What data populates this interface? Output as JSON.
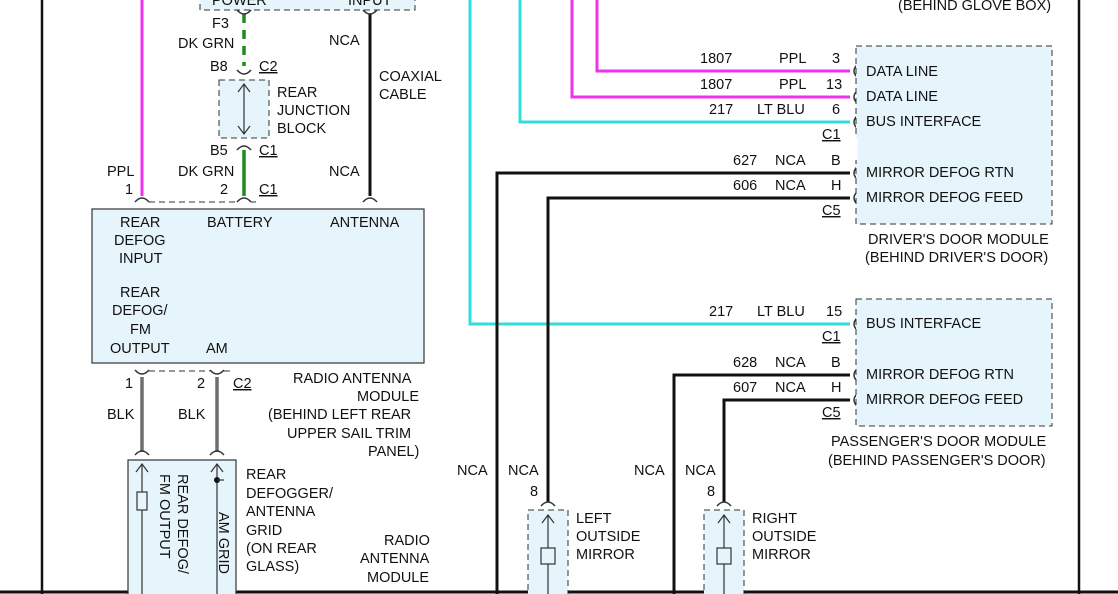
{
  "colors": {
    "ppl": "#ee33ee",
    "lt_blu": "#33dddd",
    "dk_grn": "#1f8a1f",
    "blk": "#111111",
    "blk_gray": "#6e6e6e",
    "module_fill": "#e6f4fb"
  },
  "top_left": {
    "power": "POWER",
    "input": "INPUT",
    "f3_pin": "F3",
    "f3_wire": "DK GRN",
    "nca_top": "NCA",
    "b8_pin": "B8",
    "c2_conn": "C2",
    "coaxial": "COAXIAL",
    "cable": "CABLE",
    "junction_l1": "REAR",
    "junction_l2": "JUNCTION",
    "junction_l3": "BLOCK",
    "b5_pin": "B5",
    "c1_conn_a": "C1",
    "ppl_wire": "PPL",
    "pin1": "1",
    "dk_grn_low": "DK GRN",
    "pin2": "2",
    "c1_conn_b": "C1",
    "nca_ant": "NCA",
    "behind_glove_box": "(BEHIND GLOVE BOX)"
  },
  "radio_antenna_module": {
    "rear_defog_input_l1": "REAR",
    "rear_defog_input_l2": "DEFOG",
    "rear_defog_input_l3": "INPUT",
    "battery": "BATTERY",
    "antenna": "ANTENNA",
    "rear_defog_fm_l1": "REAR",
    "rear_defog_fm_l2": "DEFOG/",
    "rear_defog_fm_l3": "FM",
    "rear_defog_fm_l4": "OUTPUT",
    "am": "AM",
    "pin1": "1",
    "pin2": "2",
    "c2": "C2",
    "caption_l1": "RADIO ANTENNA",
    "caption_l2": "MODULE",
    "caption_l3": "(BEHIND LEFT REAR",
    "caption_l4": "UPPER SAIL TRIM",
    "caption_l5": "PANEL)",
    "blk1": "BLK",
    "blk2": "BLK"
  },
  "grid": {
    "vertical_left": "REAR DEFOG/",
    "vertical_left2": "FM OUTPUT",
    "vertical_right": "AM GRID",
    "label_l1": "REAR",
    "label_l2": "DEFOGGER/",
    "label_l3": "ANTENNA",
    "label_l4": "GRID",
    "label_l5": "(ON REAR",
    "label_l6": "GLASS)",
    "radio_l1": "RADIO",
    "radio_l2": "ANTENNA",
    "radio_l3": "MODULE"
  },
  "drivers_door": {
    "w1_circuit": "1807",
    "w1_color": "PPL",
    "w1_pin": "3",
    "w1_label": "DATA LINE",
    "w2_circuit": "1807",
    "w2_color": "PPL",
    "w2_pin": "13",
    "w2_label": "DATA LINE",
    "w3_circuit": "217",
    "w3_color": "LT BLU",
    "w3_pin": "6",
    "w3_label": "BUS INTERFACE",
    "c1": "C1",
    "w4_circuit": "627",
    "w4_color": "NCA",
    "w4_pin": "B",
    "w4_label": "MIRROR DEFOG RTN",
    "w5_circuit": "606",
    "w5_color": "NCA",
    "w5_pin": "H",
    "w5_label": "MIRROR DEFOG FEED",
    "c5": "C5",
    "caption_l1": "DRIVER'S DOOR MODULE",
    "caption_l2": "(BEHIND DRIVER'S DOOR)"
  },
  "passenger_door": {
    "w1_circuit": "217",
    "w1_color": "LT BLU",
    "w1_pin": "15",
    "w1_label": "BUS INTERFACE",
    "c1": "C1",
    "w2_circuit": "628",
    "w2_color": "NCA",
    "w2_pin": "B",
    "w2_label": "MIRROR DEFOG RTN",
    "w3_circuit": "607",
    "w3_color": "NCA",
    "w3_pin": "H",
    "w3_label": "MIRROR DEFOG FEED",
    "c5": "C5",
    "caption_l1": "PASSENGER'S DOOR MODULE",
    "caption_l2": "(BEHIND PASSENGER'S DOOR)"
  },
  "mirrors": {
    "left_nca1": "NCA",
    "left_nca2": "NCA",
    "left_pin": "8",
    "left_l1": "LEFT",
    "left_l2": "OUTSIDE",
    "left_l3": "MIRROR",
    "right_nca1": "NCA",
    "right_nca2": "NCA",
    "right_pin": "8",
    "right_l1": "RIGHT",
    "right_l2": "OUTSIDE",
    "right_l3": "MIRROR"
  }
}
